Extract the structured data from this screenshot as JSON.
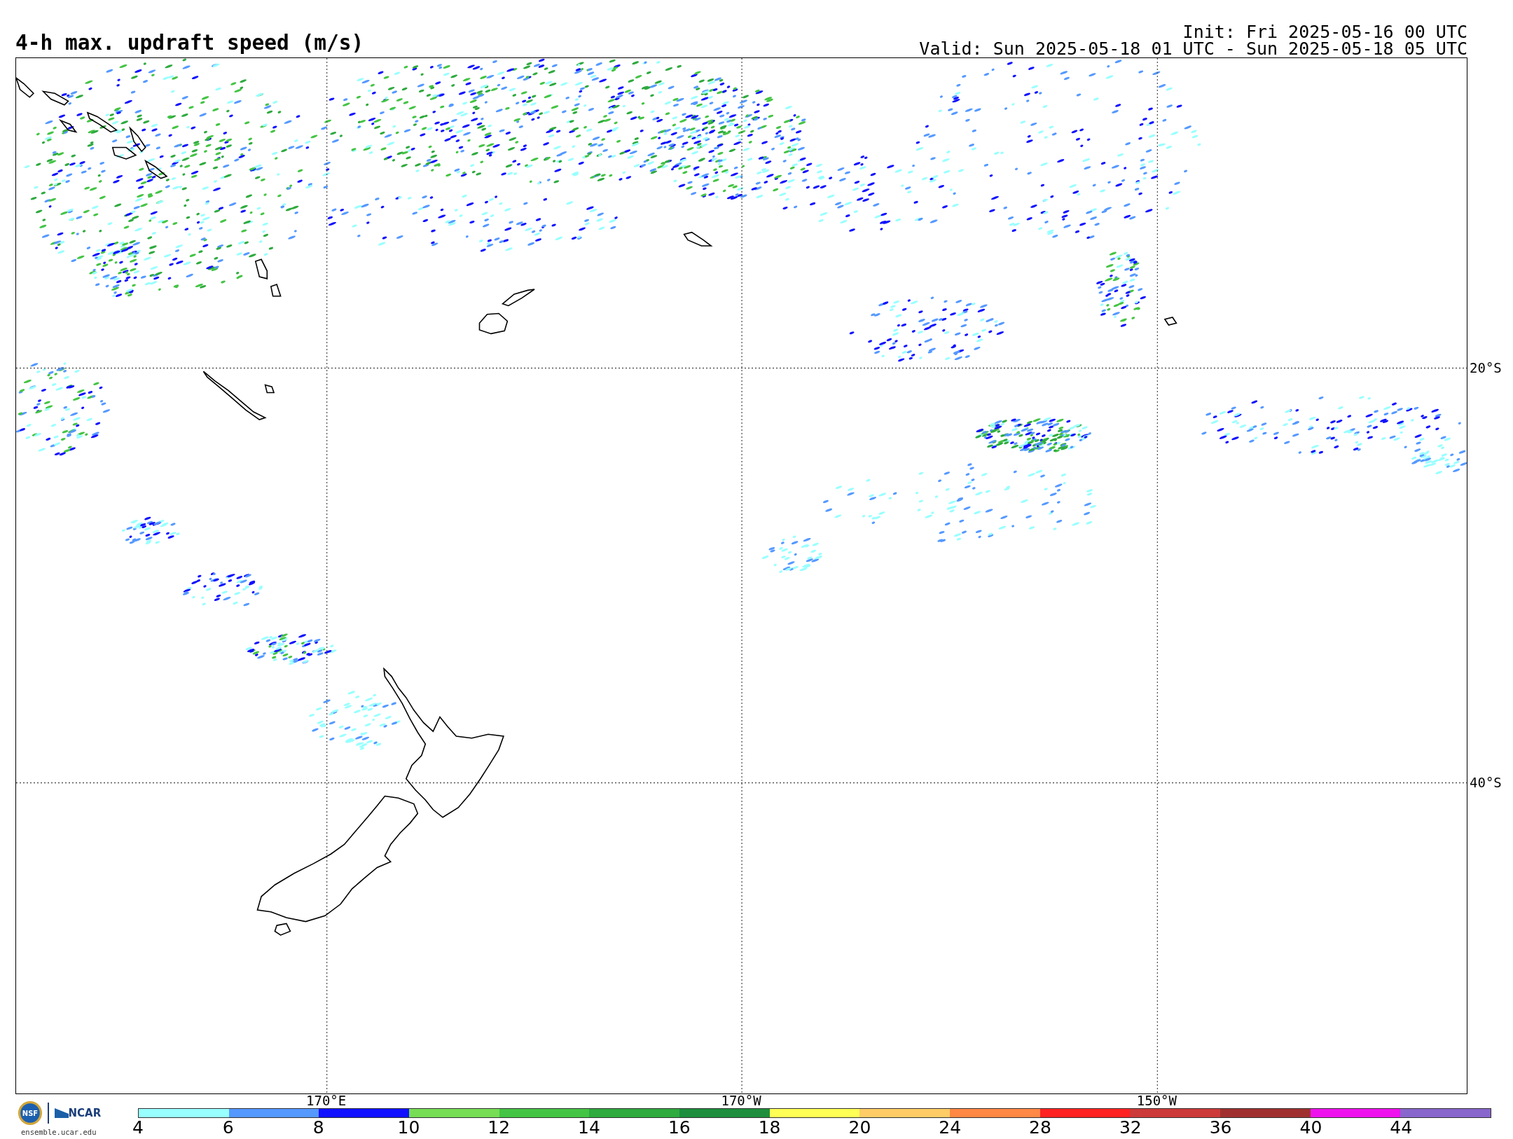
{
  "title": "4-h max. updraft speed (m/s)",
  "init": "Init: Fri 2025-05-16 00 UTC",
  "valid": "Valid: Sun 2025-05-18 01 UTC - Sun 2025-05-18 05 UTC",
  "longitudes": [
    {
      "label": "170°E"
    },
    {
      "label": "170°W"
    },
    {
      "label": "150°W"
    }
  ],
  "latitudes": [
    {
      "label": "20°S"
    },
    {
      "label": "40°S"
    }
  ],
  "logos": {
    "nsf": "NSF",
    "ncar": "NCAR",
    "site": "ensemble.ucar.edu"
  },
  "colorbar": {
    "segments": [
      {
        "color": "#99ffff"
      },
      {
        "color": "#5599ff"
      },
      {
        "color": "#1111ff"
      },
      {
        "color": "#77dd55"
      },
      {
        "color": "#44c444"
      },
      {
        "color": "#2eaa3e"
      },
      {
        "color": "#1e8e3e"
      },
      {
        "color": "#ffff55"
      },
      {
        "color": "#ffcc66"
      },
      {
        "color": "#ff8844"
      },
      {
        "color": "#ff2222"
      },
      {
        "color": "#cc3a3a"
      },
      {
        "color": "#a03030"
      },
      {
        "color": "#ee11ee"
      },
      {
        "color": "#8866cc"
      }
    ],
    "ticks": [
      "4",
      "6",
      "8",
      "10",
      "12",
      "14",
      "16",
      "18",
      "20",
      "24",
      "28",
      "32",
      "36",
      "40",
      "44"
    ]
  }
}
